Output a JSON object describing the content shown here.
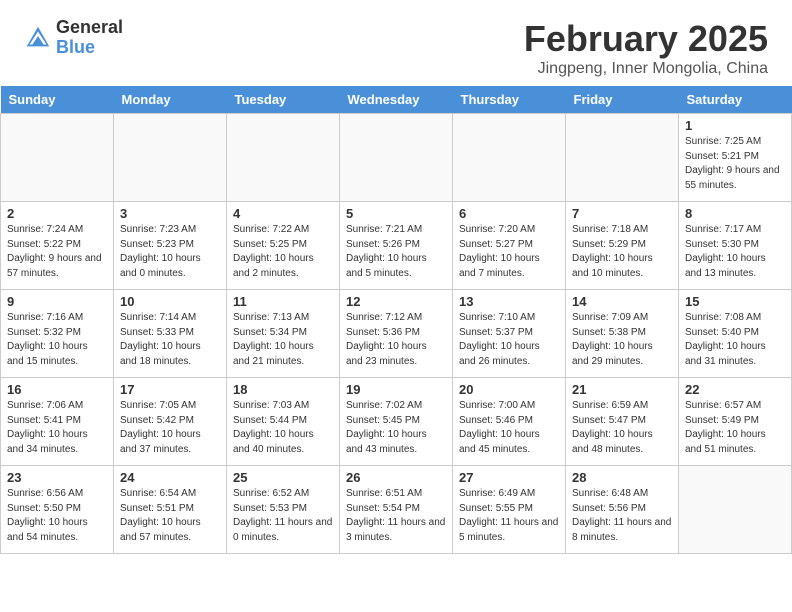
{
  "header": {
    "logo_general": "General",
    "logo_blue": "Blue",
    "month_title": "February 2025",
    "location": "Jingpeng, Inner Mongolia, China"
  },
  "days_of_week": [
    "Sunday",
    "Monday",
    "Tuesday",
    "Wednesday",
    "Thursday",
    "Friday",
    "Saturday"
  ],
  "weeks": [
    [
      {
        "day": "",
        "info": ""
      },
      {
        "day": "",
        "info": ""
      },
      {
        "day": "",
        "info": ""
      },
      {
        "day": "",
        "info": ""
      },
      {
        "day": "",
        "info": ""
      },
      {
        "day": "",
        "info": ""
      },
      {
        "day": "1",
        "info": "Sunrise: 7:25 AM\nSunset: 5:21 PM\nDaylight: 9 hours\nand 55 minutes."
      }
    ],
    [
      {
        "day": "2",
        "info": "Sunrise: 7:24 AM\nSunset: 5:22 PM\nDaylight: 9 hours\nand 57 minutes."
      },
      {
        "day": "3",
        "info": "Sunrise: 7:23 AM\nSunset: 5:23 PM\nDaylight: 10 hours\nand 0 minutes."
      },
      {
        "day": "4",
        "info": "Sunrise: 7:22 AM\nSunset: 5:25 PM\nDaylight: 10 hours\nand 2 minutes."
      },
      {
        "day": "5",
        "info": "Sunrise: 7:21 AM\nSunset: 5:26 PM\nDaylight: 10 hours\nand 5 minutes."
      },
      {
        "day": "6",
        "info": "Sunrise: 7:20 AM\nSunset: 5:27 PM\nDaylight: 10 hours\nand 7 minutes."
      },
      {
        "day": "7",
        "info": "Sunrise: 7:18 AM\nSunset: 5:29 PM\nDaylight: 10 hours\nand 10 minutes."
      },
      {
        "day": "8",
        "info": "Sunrise: 7:17 AM\nSunset: 5:30 PM\nDaylight: 10 hours\nand 13 minutes."
      }
    ],
    [
      {
        "day": "9",
        "info": "Sunrise: 7:16 AM\nSunset: 5:32 PM\nDaylight: 10 hours\nand 15 minutes."
      },
      {
        "day": "10",
        "info": "Sunrise: 7:14 AM\nSunset: 5:33 PM\nDaylight: 10 hours\nand 18 minutes."
      },
      {
        "day": "11",
        "info": "Sunrise: 7:13 AM\nSunset: 5:34 PM\nDaylight: 10 hours\nand 21 minutes."
      },
      {
        "day": "12",
        "info": "Sunrise: 7:12 AM\nSunset: 5:36 PM\nDaylight: 10 hours\nand 23 minutes."
      },
      {
        "day": "13",
        "info": "Sunrise: 7:10 AM\nSunset: 5:37 PM\nDaylight: 10 hours\nand 26 minutes."
      },
      {
        "day": "14",
        "info": "Sunrise: 7:09 AM\nSunset: 5:38 PM\nDaylight: 10 hours\nand 29 minutes."
      },
      {
        "day": "15",
        "info": "Sunrise: 7:08 AM\nSunset: 5:40 PM\nDaylight: 10 hours\nand 31 minutes."
      }
    ],
    [
      {
        "day": "16",
        "info": "Sunrise: 7:06 AM\nSunset: 5:41 PM\nDaylight: 10 hours\nand 34 minutes."
      },
      {
        "day": "17",
        "info": "Sunrise: 7:05 AM\nSunset: 5:42 PM\nDaylight: 10 hours\nand 37 minutes."
      },
      {
        "day": "18",
        "info": "Sunrise: 7:03 AM\nSunset: 5:44 PM\nDaylight: 10 hours\nand 40 minutes."
      },
      {
        "day": "19",
        "info": "Sunrise: 7:02 AM\nSunset: 5:45 PM\nDaylight: 10 hours\nand 43 minutes."
      },
      {
        "day": "20",
        "info": "Sunrise: 7:00 AM\nSunset: 5:46 PM\nDaylight: 10 hours\nand 45 minutes."
      },
      {
        "day": "21",
        "info": "Sunrise: 6:59 AM\nSunset: 5:47 PM\nDaylight: 10 hours\nand 48 minutes."
      },
      {
        "day": "22",
        "info": "Sunrise: 6:57 AM\nSunset: 5:49 PM\nDaylight: 10 hours\nand 51 minutes."
      }
    ],
    [
      {
        "day": "23",
        "info": "Sunrise: 6:56 AM\nSunset: 5:50 PM\nDaylight: 10 hours\nand 54 minutes."
      },
      {
        "day": "24",
        "info": "Sunrise: 6:54 AM\nSunset: 5:51 PM\nDaylight: 10 hours\nand 57 minutes."
      },
      {
        "day": "25",
        "info": "Sunrise: 6:52 AM\nSunset: 5:53 PM\nDaylight: 11 hours\nand 0 minutes."
      },
      {
        "day": "26",
        "info": "Sunrise: 6:51 AM\nSunset: 5:54 PM\nDaylight: 11 hours\nand 3 minutes."
      },
      {
        "day": "27",
        "info": "Sunrise: 6:49 AM\nSunset: 5:55 PM\nDaylight: 11 hours\nand 5 minutes."
      },
      {
        "day": "28",
        "info": "Sunrise: 6:48 AM\nSunset: 5:56 PM\nDaylight: 11 hours\nand 8 minutes."
      },
      {
        "day": "",
        "info": ""
      }
    ]
  ]
}
